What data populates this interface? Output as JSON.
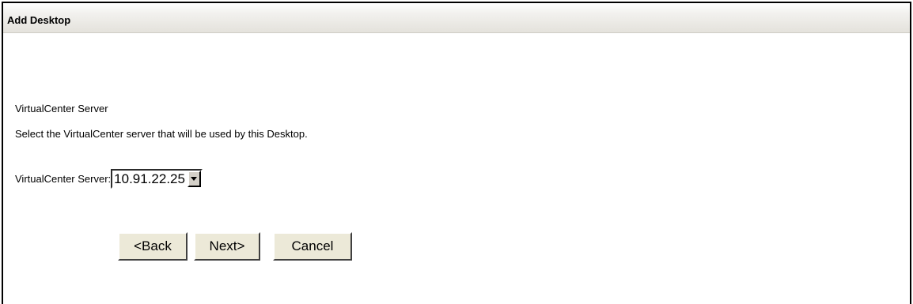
{
  "window": {
    "title": "Add Desktop"
  },
  "section": {
    "title": "VirtualCenter Server",
    "description": "Select the VirtualCenter server that will be used by this Desktop."
  },
  "field": {
    "label": "VirtualCenter Server:",
    "selected_value": "10.91.22.25"
  },
  "buttons": {
    "back": "<Back",
    "next": "Next>",
    "cancel": "Cancel"
  },
  "colors": {
    "titlebar_gradient_end": "#e4e2dc",
    "button_face": "#ece9d8"
  }
}
